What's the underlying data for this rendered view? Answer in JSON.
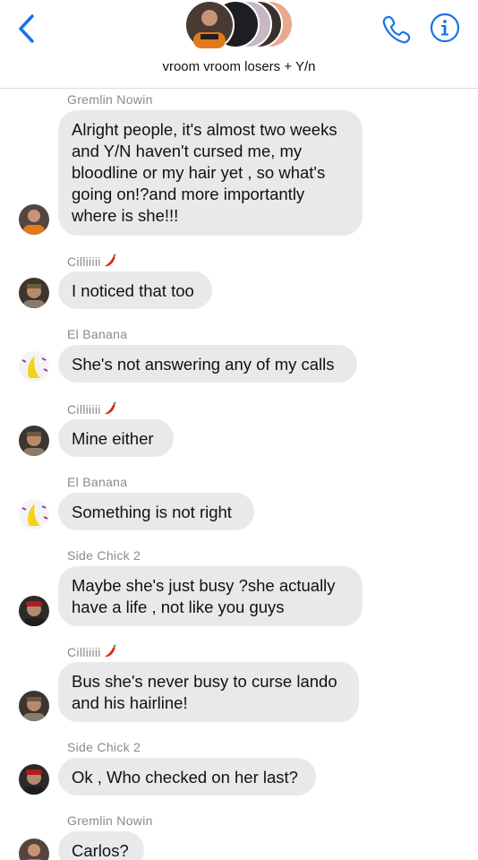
{
  "header": {
    "group_title": "vroom vroom losers + Y/n",
    "back_icon": "chevron-left-icon",
    "call_icon": "phone-icon",
    "info_icon": "info-icon",
    "accent_color": "#1a73e8"
  },
  "messages": [
    {
      "sender": "Gremlin Nowin",
      "lines": [
        "Alright people, it's almost two weeks",
        "and Y/N haven't cursed me, my",
        "bloodline or my hair yet , so what's",
        "going on!?and more importantly",
        "where is she!!!"
      ]
    },
    {
      "sender": "Cilliiiii",
      "sender_emoji": "chili-pepper-icon",
      "lines": [
        "I noticed that too"
      ]
    },
    {
      "sender": "El Banana",
      "lines": [
        "She's not answering any of my calls"
      ]
    },
    {
      "sender": "Cilliiiii",
      "sender_emoji": "chili-pepper-icon",
      "lines": [
        "Mine either"
      ]
    },
    {
      "sender": "El Banana",
      "lines": [
        "Something is not right"
      ]
    },
    {
      "sender": "Side Chick 2",
      "lines": [
        "Maybe she's just busy ?she  actually",
        "have a life , not like you guys"
      ]
    },
    {
      "sender": "Cilliiiii",
      "sender_emoji": "chili-pepper-icon",
      "lines": [
        "Bus she's never busy to curse lando",
        "and his hairline!"
      ]
    },
    {
      "sender": "Side Chick 2",
      "lines": [
        "Ok , Who checked on her last?"
      ]
    },
    {
      "sender": "Gremlin Nowin",
      "lines": [
        "Carlos?"
      ]
    }
  ],
  "colors": {
    "bubble_bg": "#e9e9eb",
    "sender_text": "#8a8a8e",
    "pepper_red": "#d9291c"
  }
}
